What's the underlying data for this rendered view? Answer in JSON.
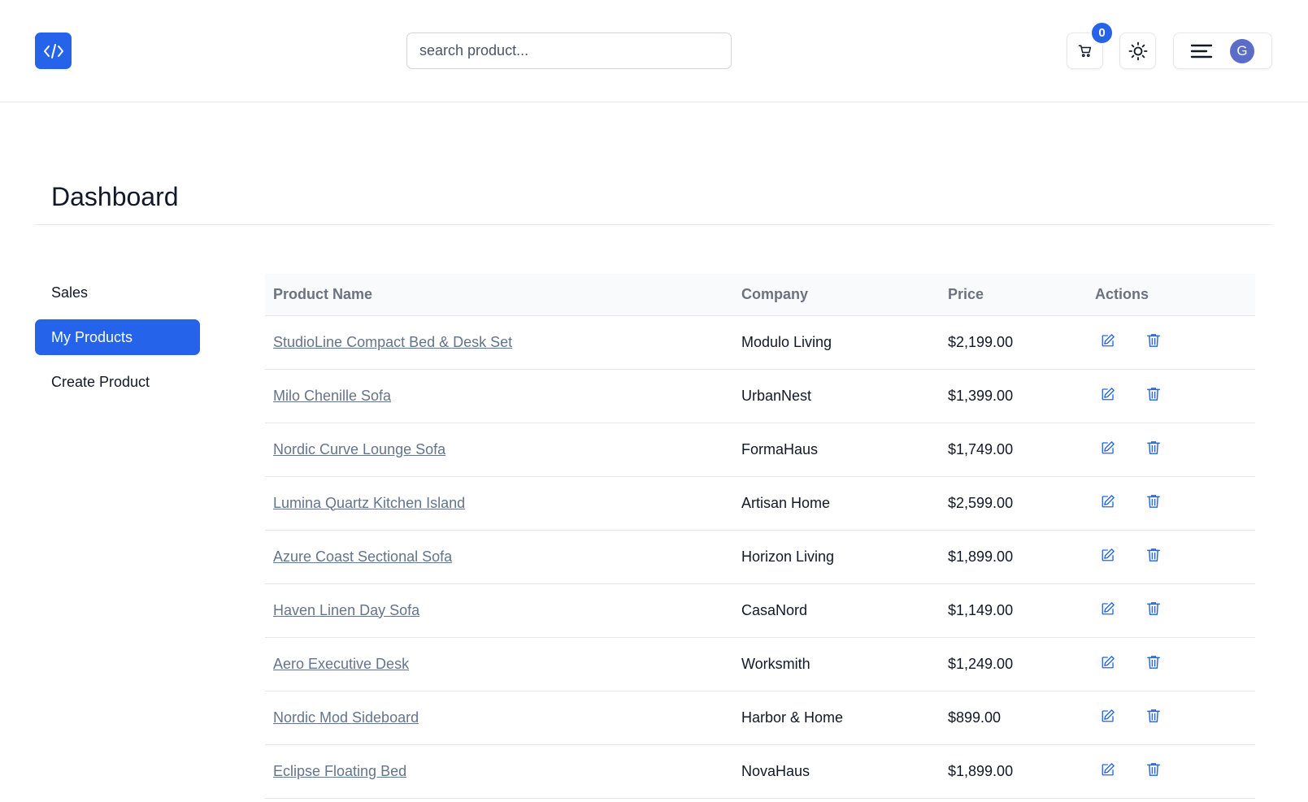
{
  "header": {
    "logo_icon": "code-icon",
    "search_placeholder": "search product...",
    "cart_count": "0",
    "avatar_initial": "G",
    "accent": "#2563eb"
  },
  "page": {
    "title": "Dashboard"
  },
  "sidebar": {
    "items": [
      {
        "label": "Sales",
        "active": false
      },
      {
        "label": "My Products",
        "active": true
      },
      {
        "label": "Create Product",
        "active": false
      }
    ]
  },
  "table": {
    "headers": [
      "Product Name",
      "Company",
      "Price",
      "Actions"
    ],
    "rows": [
      {
        "name": "StudioLine Compact Bed & Desk Set",
        "company": "Modulo Living",
        "price": "$2,199.00"
      },
      {
        "name": "Milo Chenille Sofa",
        "company": "UrbanNest",
        "price": "$1,399.00"
      },
      {
        "name": "Nordic Curve Lounge Sofa",
        "company": "FormaHaus",
        "price": "$1,749.00"
      },
      {
        "name": "Lumina Quartz Kitchen Island",
        "company": "Artisan Home",
        "price": "$2,599.00"
      },
      {
        "name": "Azure Coast Sectional Sofa",
        "company": "Horizon Living",
        "price": "$1,899.00"
      },
      {
        "name": "Haven Linen Day Sofa",
        "company": "CasaNord",
        "price": "$1,149.00"
      },
      {
        "name": "Aero Executive Desk",
        "company": "Worksmith",
        "price": "$1,249.00"
      },
      {
        "name": "Nordic Mod Sideboard",
        "company": "Harbor & Home",
        "price": "$899.00"
      },
      {
        "name": "Eclipse Floating Bed",
        "company": "NovaHaus",
        "price": "$1,899.00"
      }
    ],
    "action_icons": [
      "edit-icon",
      "trash-icon"
    ]
  }
}
